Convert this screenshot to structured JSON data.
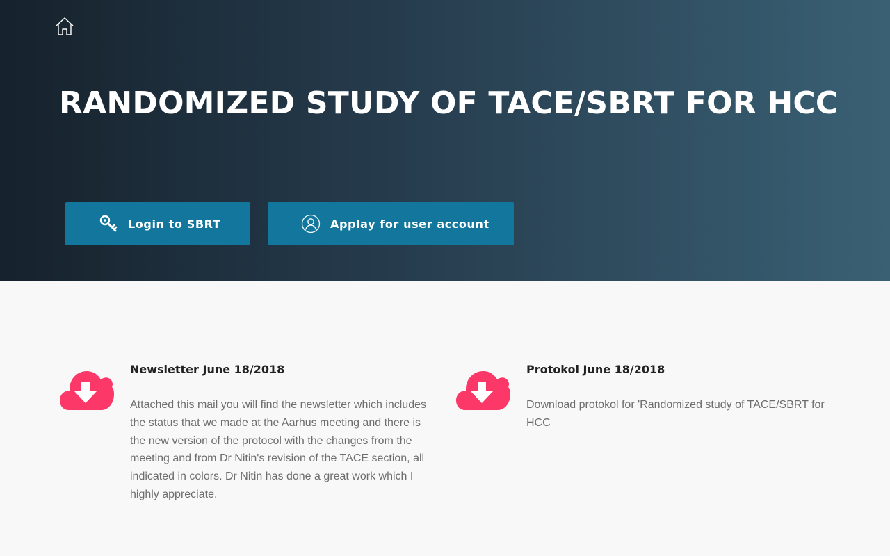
{
  "hero": {
    "title": "RANDOMIZED STUDY OF TACE/SBRT FOR HCC",
    "home_icon": "home-icon"
  },
  "buttons": {
    "login": {
      "label": "Login to SBRT",
      "icon": "key-icon"
    },
    "apply": {
      "label": "Applay for user account",
      "icon": "user-circle-icon"
    }
  },
  "downloads": [
    {
      "title": "Newsletter June 18/2018",
      "text": "Attached this mail you will find the newsletter which includes the status that we made at the Aarhus meeting and there is the new version of the protocol with the changes from the meeting and from Dr Nitin's revision of the TACE section, all indicated in colors. Dr Nitin has done a great work which I highly appreciate.",
      "icon": "cloud-download-icon"
    },
    {
      "title": "Protokol June 18/2018",
      "text": "Download protokol for 'Randomized study of TACE/SBRT for HCC",
      "icon": "cloud-download-icon"
    }
  ],
  "colors": {
    "accent_button": "#13779d",
    "download_icon": "#fc3868",
    "hero_gradient_start": "#16222c",
    "hero_gradient_end": "#3a6074"
  }
}
